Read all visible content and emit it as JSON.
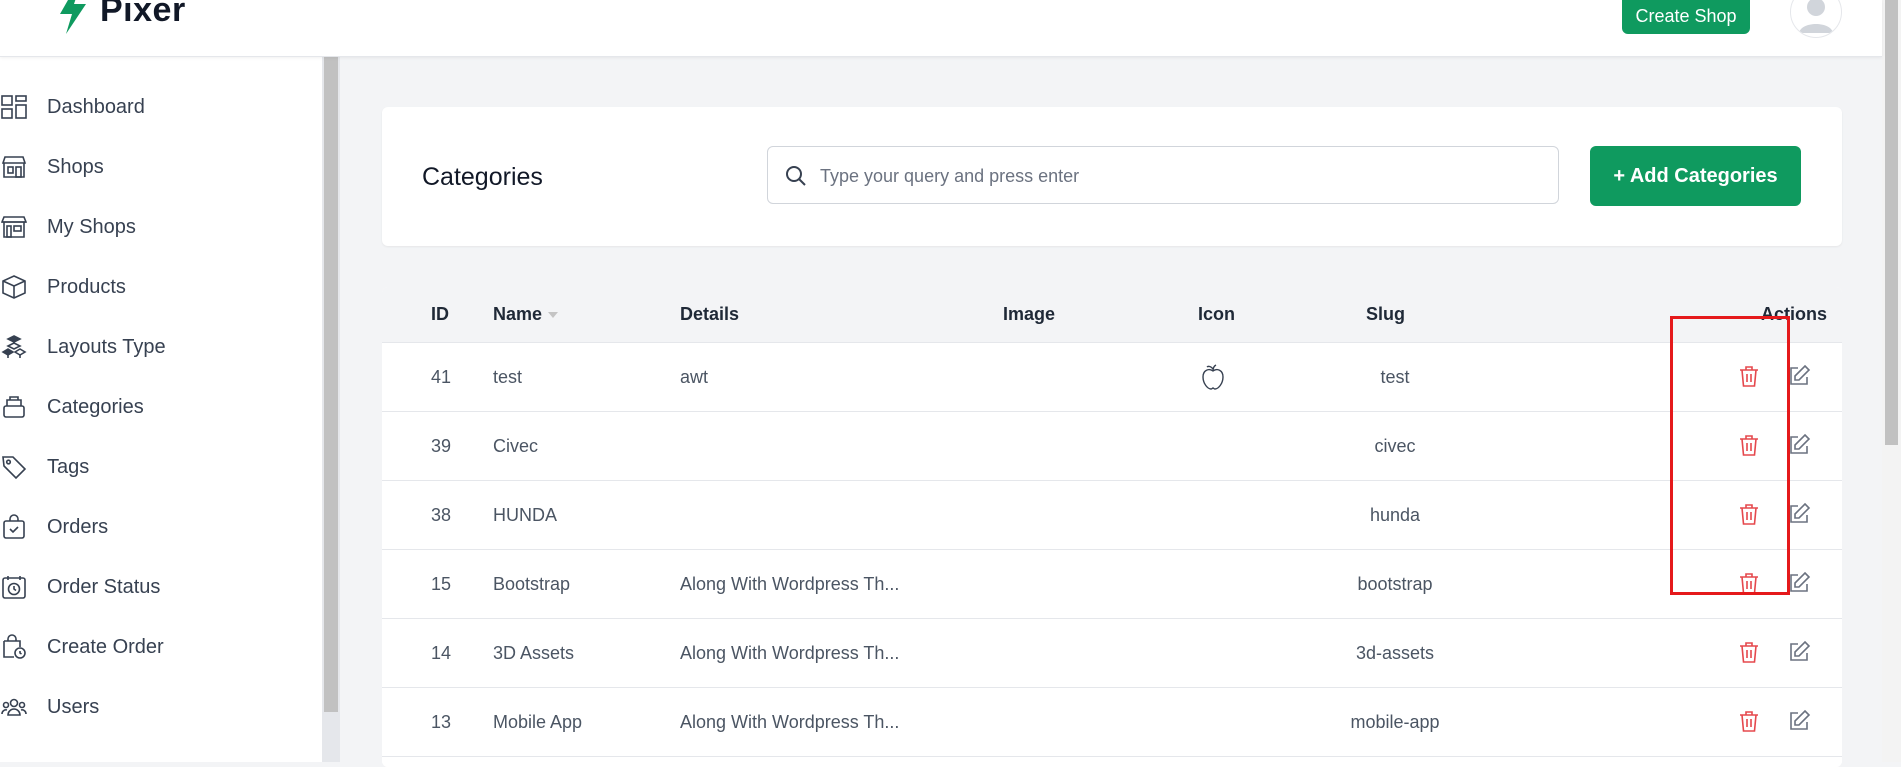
{
  "header": {
    "brand": "Pixer",
    "create_shop_label": "Create Shop"
  },
  "sidebar": {
    "items": [
      {
        "label": "Dashboard",
        "icon": "dashboard-icon"
      },
      {
        "label": "Shops",
        "icon": "shop-icon"
      },
      {
        "label": "My Shops",
        "icon": "my-shops-icon"
      },
      {
        "label": "Products",
        "icon": "box-icon"
      },
      {
        "label": "Layouts Type",
        "icon": "layouts-icon"
      },
      {
        "label": "Categories",
        "icon": "categories-icon"
      },
      {
        "label": "Tags",
        "icon": "tag-icon"
      },
      {
        "label": "Orders",
        "icon": "orders-icon"
      },
      {
        "label": "Order Status",
        "icon": "order-status-icon"
      },
      {
        "label": "Create Order",
        "icon": "create-order-icon"
      },
      {
        "label": "Users",
        "icon": "users-icon"
      }
    ]
  },
  "main": {
    "title": "Categories",
    "search_placeholder": "Type your query and press enter",
    "add_button_label": "+ Add Categories"
  },
  "table": {
    "columns": {
      "id": "ID",
      "name": "Name",
      "details": "Details",
      "image": "Image",
      "icon": "Icon",
      "slug": "Slug",
      "actions": "Actions"
    },
    "rows": [
      {
        "id": "41",
        "name": "test",
        "details": "awt",
        "icon": "apple-icon",
        "slug": "test"
      },
      {
        "id": "39",
        "name": "Civec",
        "details": "",
        "icon": "",
        "slug": "civec"
      },
      {
        "id": "38",
        "name": "HUNDA",
        "details": "",
        "icon": "",
        "slug": "hunda"
      },
      {
        "id": "15",
        "name": "Bootstrap",
        "details": "Along With Wordpress Th...",
        "icon": "",
        "slug": "bootstrap"
      },
      {
        "id": "14",
        "name": "3D Assets",
        "details": "Along With Wordpress Th...",
        "icon": "",
        "slug": "3d-assets"
      },
      {
        "id": "13",
        "name": "Mobile App",
        "details": "Along With Wordpress Th...",
        "icon": "",
        "slug": "mobile-app"
      }
    ]
  },
  "colors": {
    "brand_green": "#0f9a5f",
    "delete_red": "#e5484d",
    "highlight_red": "#e5191b"
  }
}
